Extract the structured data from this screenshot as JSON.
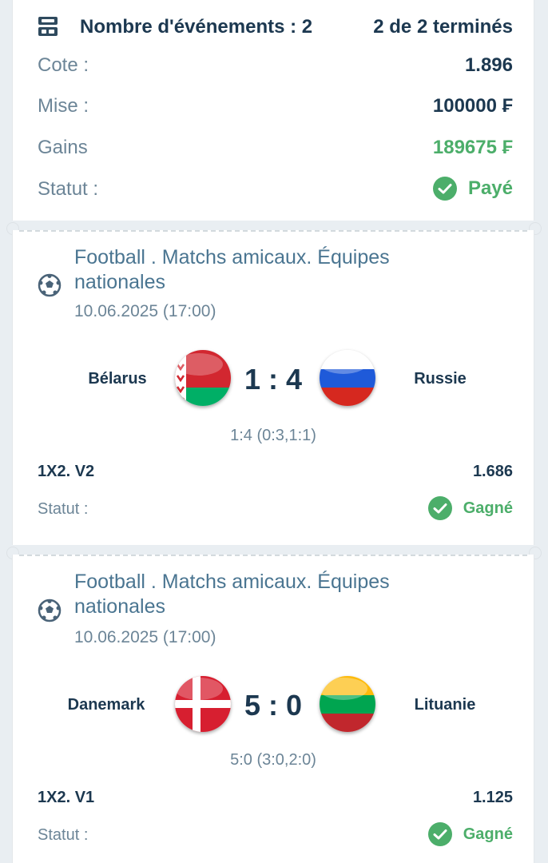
{
  "summary": {
    "events_label": "Nombre d'événements : 2",
    "completed_label": "2 de 2 terminés",
    "rows": [
      {
        "label": "Cote :",
        "value": "1.896"
      },
      {
        "label": "Mise :",
        "value": "100000 ₣"
      },
      {
        "label": "Gains",
        "value": "189675 ₣"
      },
      {
        "label": "Statut :",
        "value": "Payé"
      }
    ]
  },
  "events": [
    {
      "league_line1": "Football . Matchs amicaux. Équipes",
      "league_line2": "nationales",
      "date": "10.06.2025 (17:00)",
      "home": "Bélarus",
      "away": "Russie",
      "score": "1 : 4",
      "score_detail": "1:4 (0:3,1:1)",
      "market": "1X2. V2",
      "odd": "1.686",
      "status_label": "Statut :",
      "status_value": "Gagné"
    },
    {
      "league_line1": "Football . Matchs amicaux. Équipes",
      "league_line2": "nationales",
      "date": "10.06.2025 (17:00)",
      "home": "Danemark",
      "away": "Lituanie",
      "score": "5 : 0",
      "score_detail": "5:0 (3:0,2:0)",
      "market": "1X2. V1",
      "odd": "1.125",
      "status_label": "Statut :",
      "status_value": "Gagné"
    }
  ],
  "colors": {
    "accent_green": "#4cae6a",
    "text_dark": "#1c3850",
    "text_muted": "#6c8597",
    "league_blue": "#4a7591"
  },
  "icons": [
    "bet-slip-icon",
    "check-circle-icon",
    "soccer-ball-icon",
    "belarus-flag",
    "russia-flag",
    "denmark-flag",
    "lithuania-flag"
  ]
}
